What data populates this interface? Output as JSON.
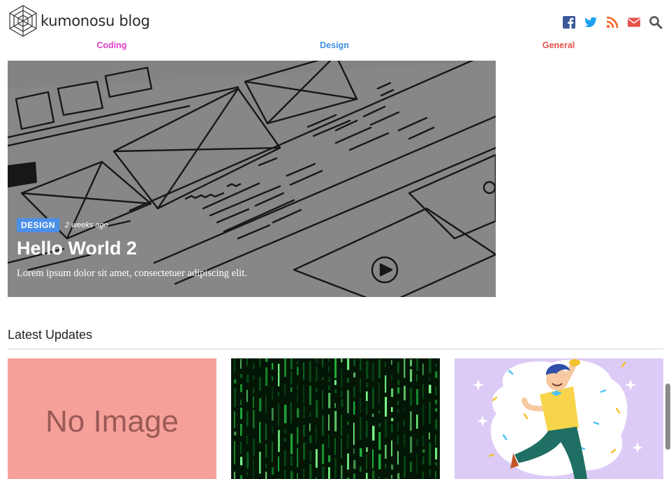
{
  "header": {
    "brand": "kumonosu blog",
    "social_icons": [
      {
        "icon": "facebook-icon",
        "color": "#3b5998"
      },
      {
        "icon": "twitter-icon",
        "color": "#1da1f2"
      },
      {
        "icon": "rss-icon",
        "color": "#f26522"
      },
      {
        "icon": "mail-icon",
        "color": "#e5534b"
      },
      {
        "icon": "search-icon",
        "color": "#555555"
      }
    ]
  },
  "nav": {
    "items": [
      {
        "label": "Coding",
        "color": "#e040c8"
      },
      {
        "label": "Design",
        "color": "#3d8fe0"
      },
      {
        "label": "General",
        "color": "#e5534b"
      }
    ]
  },
  "hero": {
    "category": "DESIGN",
    "date": "2 weeks ago",
    "title": "Hello World 2",
    "excerpt": "Lorem ipsum dolor sit amet, consectetuer adipiscing elit."
  },
  "latest": {
    "heading": "Latest Updates",
    "cards": [
      {
        "image": "no-image-placeholder",
        "placeholder_text": "No Image"
      },
      {
        "image": "matrix-code-image"
      },
      {
        "image": "celebrating-person-illustration"
      }
    ]
  }
}
